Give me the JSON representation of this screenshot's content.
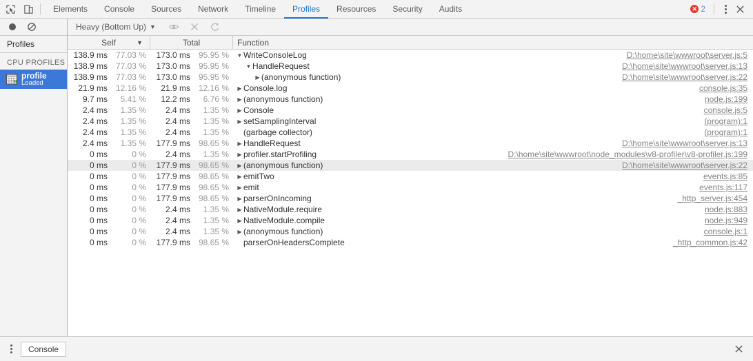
{
  "tabbar": {
    "inspect_icon": "inspect-cursor-icon",
    "device_icon": "device-toolbar-icon",
    "tabs": [
      {
        "label": "Elements",
        "active": false
      },
      {
        "label": "Console",
        "active": false
      },
      {
        "label": "Sources",
        "active": false
      },
      {
        "label": "Network",
        "active": false
      },
      {
        "label": "Timeline",
        "active": false
      },
      {
        "label": "Profiles",
        "active": true
      },
      {
        "label": "Resources",
        "active": false
      },
      {
        "label": "Security",
        "active": false
      },
      {
        "label": "Audits",
        "active": false
      }
    ],
    "error_count": "2",
    "error_color": "#e53935",
    "accent_color": "#1a73c8",
    "menu_icon": "kebab-menu-icon",
    "close_icon": "close-icon"
  },
  "sidebar": {
    "record_icon": "record-circle-icon",
    "clear_icon": "clear-no-entry-icon",
    "header": "Profiles",
    "section_label": "CPU PROFILES",
    "items": [
      {
        "title": "profile",
        "subtitle": "Loaded",
        "icon": "profile-grid-icon",
        "selected": true
      }
    ],
    "selected_color": "#3b78d8"
  },
  "toolbar": {
    "view_mode": "Heavy (Bottom Up)",
    "caret": "▼",
    "focus_icon": "eye-focus-icon",
    "exclude_icon": "close-exclude-icon",
    "restore_icon": "refresh-restore-icon"
  },
  "table": {
    "columns": [
      {
        "key": "self",
        "label": "Self",
        "sorted": true,
        "sort_dir": "▼"
      },
      {
        "key": "total",
        "label": "Total",
        "sorted": false,
        "sort_dir": ""
      },
      {
        "key": "function",
        "label": "Function",
        "sorted": false,
        "sort_dir": ""
      }
    ],
    "rows": [
      {
        "self_ms": "138.9 ms",
        "self_pct": "77.03 %",
        "total_ms": "173.0 ms",
        "total_pct": "95.95 %",
        "tri": "▼",
        "indent": 0,
        "fn": "WriteConsoleLog",
        "url": "D:\\home\\site\\wwwroot\\server.js:5",
        "highlighted": false
      },
      {
        "self_ms": "138.9 ms",
        "self_pct": "77.03 %",
        "total_ms": "173.0 ms",
        "total_pct": "95.95 %",
        "tri": "▼",
        "indent": 1,
        "fn": "HandleRequest",
        "url": "D:\\home\\site\\wwwroot\\server.js:13",
        "highlighted": false
      },
      {
        "self_ms": "138.9 ms",
        "self_pct": "77.03 %",
        "total_ms": "173.0 ms",
        "total_pct": "95.95 %",
        "tri": "▶",
        "indent": 2,
        "fn": "(anonymous function)",
        "url": "D:\\home\\site\\wwwroot\\server.js:22",
        "highlighted": false
      },
      {
        "self_ms": "21.9 ms",
        "self_pct": "12.16 %",
        "total_ms": "21.9 ms",
        "total_pct": "12.16 %",
        "tri": "▶",
        "indent": 0,
        "fn": "Console.log",
        "url": "console.js:35",
        "highlighted": false
      },
      {
        "self_ms": "9.7 ms",
        "self_pct": "5.41 %",
        "total_ms": "12.2 ms",
        "total_pct": "6.76 %",
        "tri": "▶",
        "indent": 0,
        "fn": "(anonymous function)",
        "url": "node.js:199",
        "highlighted": false
      },
      {
        "self_ms": "2.4 ms",
        "self_pct": "1.35 %",
        "total_ms": "2.4 ms",
        "total_pct": "1.35 %",
        "tri": "▶",
        "indent": 0,
        "fn": "Console",
        "url": "console.js:5",
        "highlighted": false
      },
      {
        "self_ms": "2.4 ms",
        "self_pct": "1.35 %",
        "total_ms": "2.4 ms",
        "total_pct": "1.35 %",
        "tri": "▶",
        "indent": 0,
        "fn": "setSamplingInterval",
        "url": "(program):1",
        "highlighted": false
      },
      {
        "self_ms": "2.4 ms",
        "self_pct": "1.35 %",
        "total_ms": "2.4 ms",
        "total_pct": "1.35 %",
        "tri": "",
        "indent": 0,
        "fn": "(garbage collector)",
        "url": "(program):1",
        "highlighted": false
      },
      {
        "self_ms": "2.4 ms",
        "self_pct": "1.35 %",
        "total_ms": "177.9 ms",
        "total_pct": "98.65 %",
        "tri": "▶",
        "indent": 0,
        "fn": "HandleRequest",
        "url": "D:\\home\\site\\wwwroot\\server.js:13",
        "highlighted": false
      },
      {
        "self_ms": "0 ms",
        "self_pct": "0 %",
        "total_ms": "2.4 ms",
        "total_pct": "1.35 %",
        "tri": "▶",
        "indent": 0,
        "fn": "profiler.startProfiling",
        "url": "D:\\home\\site\\wwwroot\\node_modules\\v8-profiler\\v8-profiler.js:199",
        "highlighted": false
      },
      {
        "self_ms": "0 ms",
        "self_pct": "0 %",
        "total_ms": "177.9 ms",
        "total_pct": "98.65 %",
        "tri": "▶",
        "indent": 0,
        "fn": "(anonymous function)",
        "url": "D:\\home\\site\\wwwroot\\server.js:22",
        "highlighted": true
      },
      {
        "self_ms": "0 ms",
        "self_pct": "0 %",
        "total_ms": "177.9 ms",
        "total_pct": "98.65 %",
        "tri": "▶",
        "indent": 0,
        "fn": "emitTwo",
        "url": "events.js:85",
        "highlighted": false
      },
      {
        "self_ms": "0 ms",
        "self_pct": "0 %",
        "total_ms": "177.9 ms",
        "total_pct": "98.65 %",
        "tri": "▶",
        "indent": 0,
        "fn": "emit",
        "url": "events.js:117",
        "highlighted": false
      },
      {
        "self_ms": "0 ms",
        "self_pct": "0 %",
        "total_ms": "177.9 ms",
        "total_pct": "98.65 %",
        "tri": "▶",
        "indent": 0,
        "fn": "parserOnIncoming",
        "url": "_http_server.js:454",
        "highlighted": false
      },
      {
        "self_ms": "0 ms",
        "self_pct": "0 %",
        "total_ms": "2.4 ms",
        "total_pct": "1.35 %",
        "tri": "▶",
        "indent": 0,
        "fn": "NativeModule.require",
        "url": "node.js:883",
        "highlighted": false
      },
      {
        "self_ms": "0 ms",
        "self_pct": "0 %",
        "total_ms": "2.4 ms",
        "total_pct": "1.35 %",
        "tri": "▶",
        "indent": 0,
        "fn": "NativeModule.compile",
        "url": "node.js:949",
        "highlighted": false
      },
      {
        "self_ms": "0 ms",
        "self_pct": "0 %",
        "total_ms": "2.4 ms",
        "total_pct": "1.35 %",
        "tri": "▶",
        "indent": 0,
        "fn": "(anonymous function)",
        "url": "console.js:1",
        "highlighted": false
      },
      {
        "self_ms": "0 ms",
        "self_pct": "0 %",
        "total_ms": "177.9 ms",
        "total_pct": "98.65 %",
        "tri": "",
        "indent": 0,
        "fn": "parserOnHeadersComplete",
        "url": "_http_common.js:42",
        "highlighted": false
      }
    ]
  },
  "drawer": {
    "menu_icon": "kebab-menu-icon",
    "tab_label": "Console",
    "close_icon": "close-icon"
  }
}
